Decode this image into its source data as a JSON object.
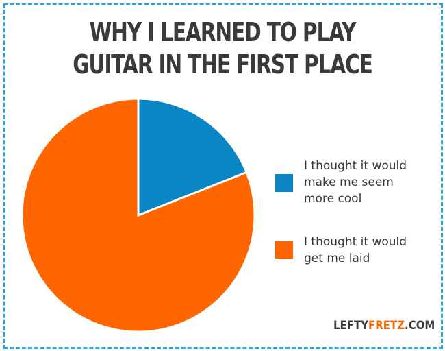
{
  "chart_data": {
    "type": "pie",
    "title": "WHY I LEARNED TO PLAY GUITAR IN THE FIRST PLACE",
    "title_lines": [
      "WHY I LEARNED TO PLAY",
      "GUITAR IN THE FIRST PLACE"
    ],
    "slices": [
      {
        "label": "I thought it would make me seem more cool",
        "label_lines": "I thought it would\nmake me seem\nmore cool",
        "value": 19,
        "color": "#0a86c4"
      },
      {
        "label": "I thought it would get me laid",
        "label_lines": "I thought it would\nget me laid",
        "value": 81,
        "color": "#ff6600"
      }
    ],
    "legend_placement": "right",
    "start_angle_deg": 0,
    "direction": "clockwise",
    "slice_border_color": "#ffffff"
  },
  "brand": {
    "prefix": "LEFTY",
    "accent": "FRETZ",
    "suffix": ".COM",
    "accent_color": "#ff6600"
  },
  "frame": {
    "border_color": "#2aa0d8"
  }
}
